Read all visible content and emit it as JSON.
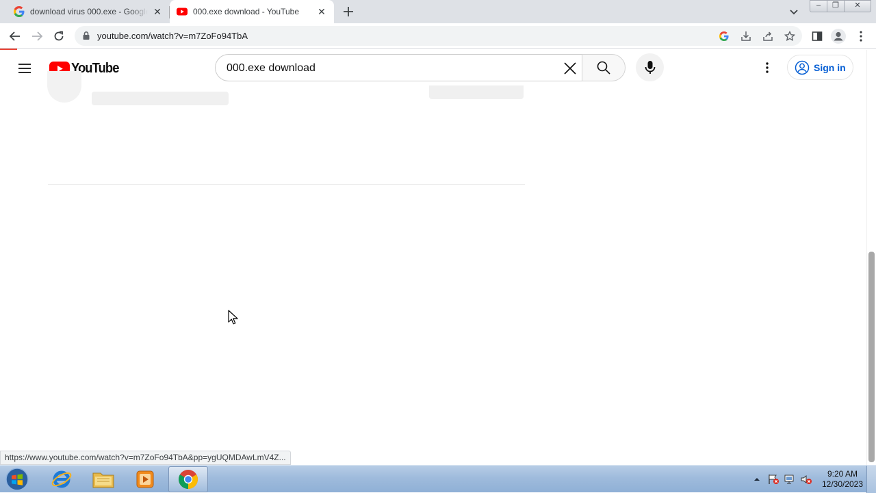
{
  "browser": {
    "tabs": [
      {
        "title": "download virus 000.exe - Google Search",
        "favicon": "google-g-icon",
        "active": false
      },
      {
        "title": "000.exe download - YouTube",
        "favicon": "youtube-icon",
        "active": true
      }
    ],
    "new_tab_icon": "plus-icon",
    "window_controls": {
      "minimize": "–",
      "maximize": "❐",
      "close": "✕"
    },
    "address": {
      "url": "youtube.com/watch?v=m7ZoFo94TbA",
      "secure_icon": "lock-icon"
    },
    "status_url": "https://www.youtube.com/watch?v=m7ZoFo94TbA&pp=ygUQMDAwLmV4Z...",
    "loading_color": "#ea4335"
  },
  "youtube": {
    "logo_text": "YouTube",
    "search": {
      "query": "000.exe download"
    },
    "sign_in_label": "Sign in",
    "brand_red": "#ff0000",
    "link_blue": "#065fd4"
  },
  "taskbar": {
    "apps": [
      "internet-explorer-icon",
      "file-explorer-icon",
      "media-player-icon",
      "chrome-icon"
    ],
    "active_app": "chrome-icon",
    "clock": {
      "time": "9:20 AM",
      "date": "12/30/2023"
    }
  }
}
